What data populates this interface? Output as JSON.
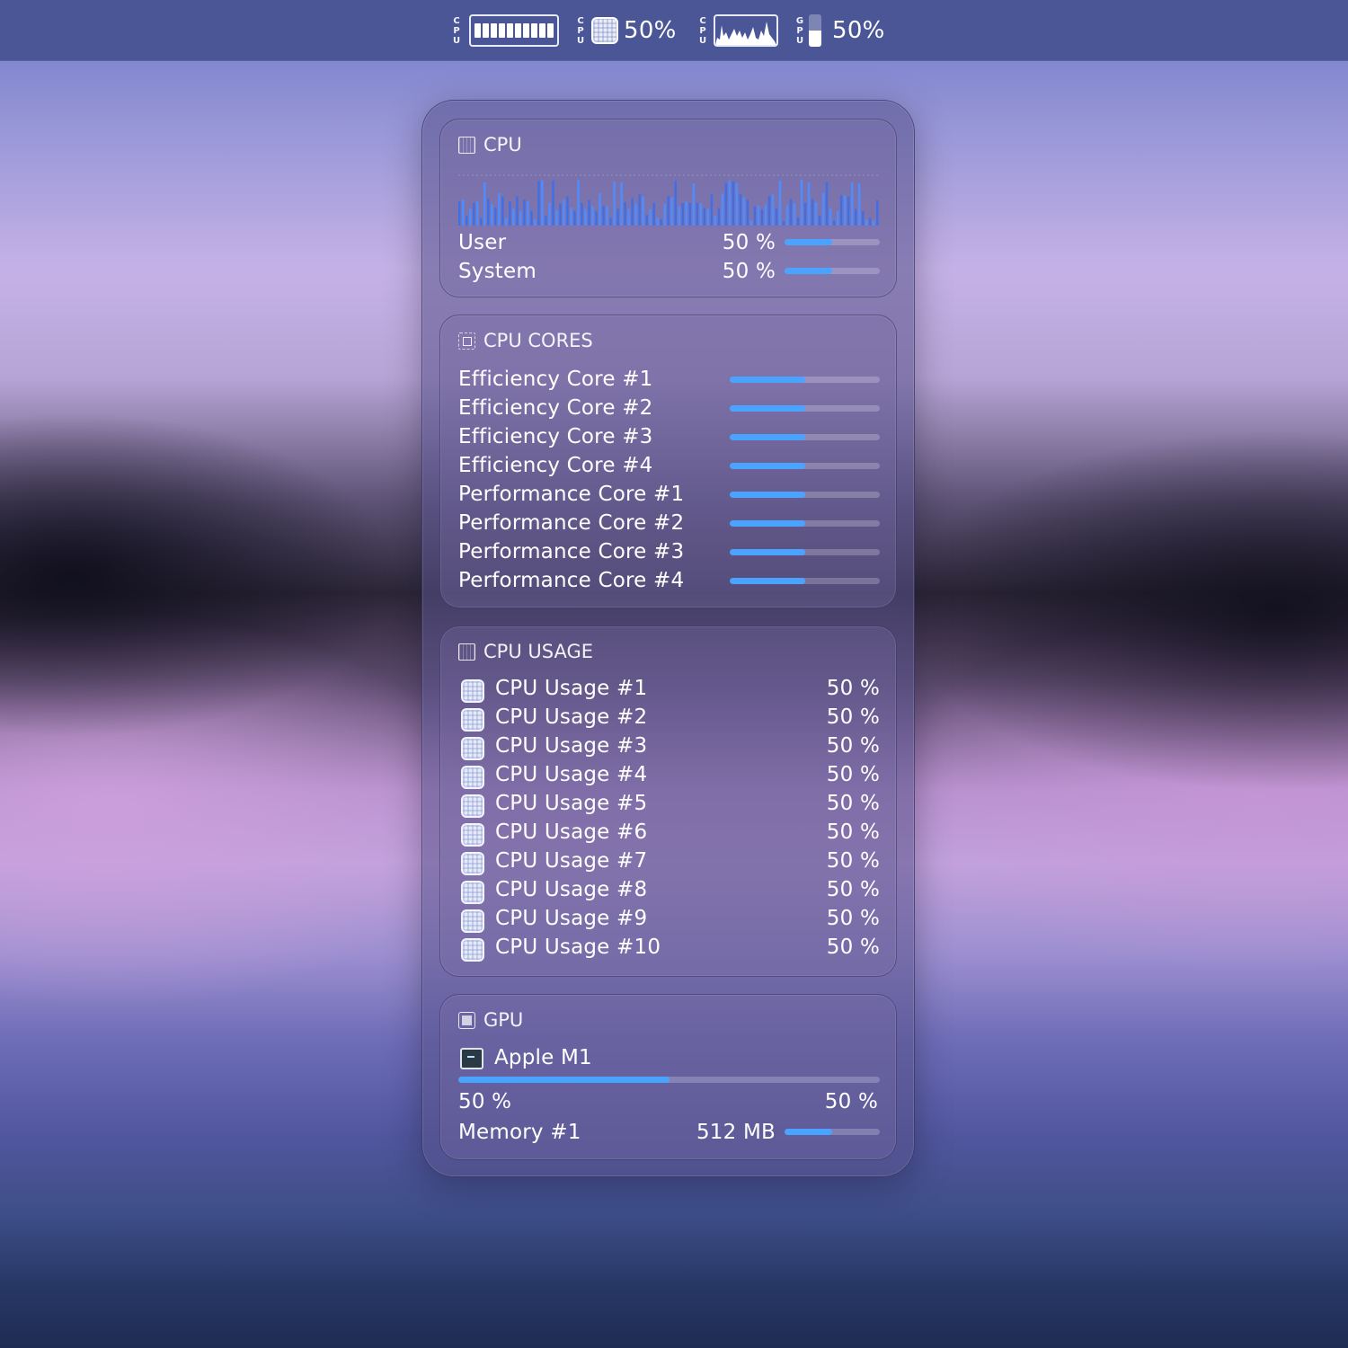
{
  "menubar": {
    "items": [
      {
        "label": [
          "C",
          "P",
          "U"
        ],
        "icon": "cpu-cores-bars-icon"
      },
      {
        "label": [
          "C",
          "P",
          "U"
        ],
        "icon": "cpu-chip-icon",
        "text": "50%"
      },
      {
        "label": [
          "C",
          "P",
          "U"
        ],
        "icon": "cpu-history-graph-icon"
      },
      {
        "label": [
          "G",
          "P",
          "U"
        ],
        "icon": "gpu-level-bar-icon",
        "text": "50%",
        "level": 0.5
      }
    ]
  },
  "cpu": {
    "title": "CPU",
    "rows": [
      {
        "label": "User",
        "value": "50 %",
        "fraction": 0.5
      },
      {
        "label": "System",
        "value": "50 %",
        "fraction": 0.5
      }
    ]
  },
  "cpu_cores": {
    "title": "CPU CORES",
    "cores": [
      {
        "label": "Efficiency Core #1",
        "fraction": 0.5
      },
      {
        "label": "Efficiency Core #2",
        "fraction": 0.5
      },
      {
        "label": "Efficiency Core #3",
        "fraction": 0.5
      },
      {
        "label": "Efficiency Core #4",
        "fraction": 0.5
      },
      {
        "label": "Performance Core #1",
        "fraction": 0.5
      },
      {
        "label": "Performance Core #2",
        "fraction": 0.5
      },
      {
        "label": "Performance Core #3",
        "fraction": 0.5
      },
      {
        "label": "Performance Core #4",
        "fraction": 0.5
      }
    ]
  },
  "cpu_usage": {
    "title": "CPU USAGE",
    "items": [
      {
        "label": "CPU Usage #1",
        "value": "50 %"
      },
      {
        "label": "CPU Usage #2",
        "value": "50 %"
      },
      {
        "label": "CPU Usage #3",
        "value": "50 %"
      },
      {
        "label": "CPU Usage #4",
        "value": "50 %"
      },
      {
        "label": "CPU Usage #5",
        "value": "50 %"
      },
      {
        "label": "CPU Usage #6",
        "value": "50 %"
      },
      {
        "label": "CPU Usage #7",
        "value": "50 %"
      },
      {
        "label": "CPU Usage #8",
        "value": "50 %"
      },
      {
        "label": "CPU Usage #9",
        "value": "50 %"
      },
      {
        "label": "CPU Usage #10",
        "value": "50 %"
      }
    ]
  },
  "gpu": {
    "title": "GPU",
    "device": "Apple M1",
    "fraction": 0.5,
    "left_value": "50 %",
    "right_value": "50 %",
    "memory": {
      "label": "Memory #1",
      "value": "512 MB",
      "fraction": 0.5
    }
  },
  "colors": {
    "accent": "#4aa4ff",
    "menubar": "#4b5697"
  }
}
